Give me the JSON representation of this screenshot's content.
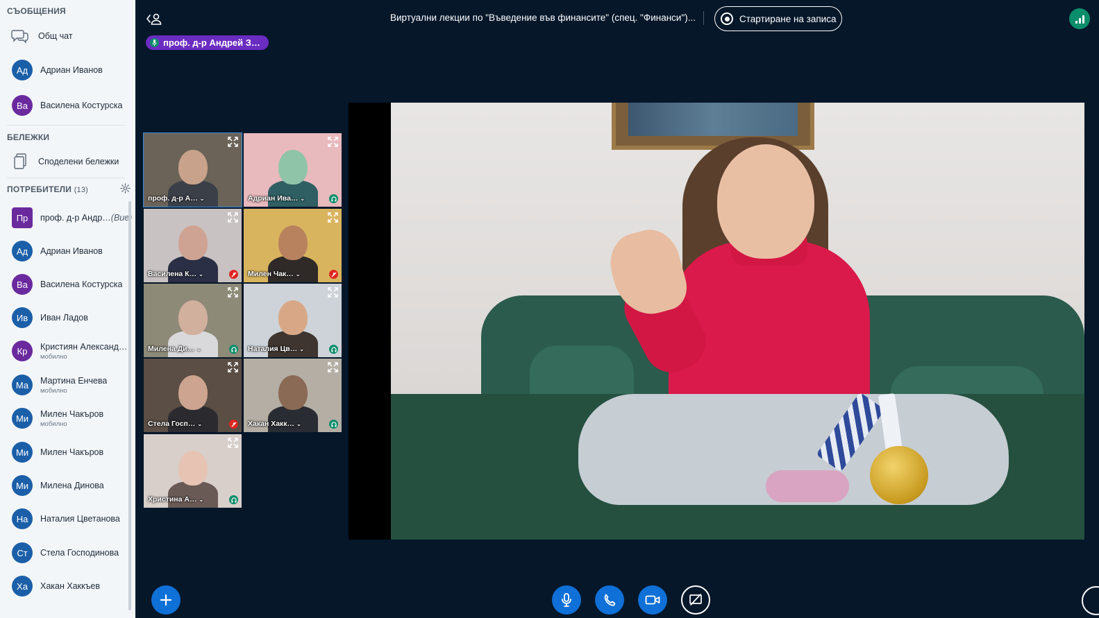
{
  "sidebar": {
    "messages_title": "СЪОБЩЕНИЯ",
    "public_chat": "Общ чат",
    "private_chats": [
      {
        "initials": "Ад",
        "name": "Адриан Иванов",
        "color": "#1B5FA8"
      },
      {
        "initials": "Ва",
        "name": "Василена Костурска",
        "color": "#6A2A9E"
      }
    ],
    "notes_title": "БЕЛЕЖКИ",
    "shared_notes": "Споделени бележки",
    "users_title": "ПОТРЕБИТЕЛИ",
    "users_count": "(13)",
    "users": [
      {
        "initials": "Пр",
        "name": "проф. д-р Андр…",
        "you": "(Вие)",
        "sub": "",
        "color": "#6A2A9E",
        "status": "listen",
        "presenter": true
      },
      {
        "initials": "Ад",
        "name": "Адриан Иванов",
        "you": "",
        "sub": "",
        "color": "#1B5FA8",
        "status": "listen"
      },
      {
        "initials": "Ва",
        "name": "Василена Костурска",
        "you": "",
        "sub": "",
        "color": "#6A2A9E",
        "status": "muted"
      },
      {
        "initials": "Ив",
        "name": "Иван Ладов",
        "you": "",
        "sub": "",
        "color": "#1B5FA8",
        "status": "listen"
      },
      {
        "initials": "Кр",
        "name": "Кристиян Александ…",
        "you": "",
        "sub": "мобилно",
        "color": "#6A2A9E",
        "status": "listen"
      },
      {
        "initials": "Ма",
        "name": "Мартина Енчева",
        "you": "",
        "sub": "мобилно",
        "color": "#1B5FA8",
        "status": "listen"
      },
      {
        "initials": "Ми",
        "name": "Милен Чакъров",
        "you": "",
        "sub": "мобилно",
        "color": "#1B5FA8",
        "status": "muted"
      },
      {
        "initials": "Ми",
        "name": "Милен Чакъров",
        "you": "",
        "sub": "",
        "color": "#1B5FA8",
        "status": "listen"
      },
      {
        "initials": "Ми",
        "name": "Милена Динова",
        "you": "",
        "sub": "",
        "color": "#1B5FA8",
        "status": "listen"
      },
      {
        "initials": "На",
        "name": "Наталия Цветанова",
        "you": "",
        "sub": "",
        "color": "#1B5FA8",
        "status": "listen"
      },
      {
        "initials": "Ст",
        "name": "Стела Господинова",
        "you": "",
        "sub": "",
        "color": "#1B5FA8",
        "status": "muted"
      },
      {
        "initials": "Ха",
        "name": "Хакан Хаккъев",
        "you": "",
        "sub": "",
        "color": "#1B5FA8",
        "status": "listen"
      }
    ]
  },
  "topbar": {
    "meeting_title": "Виртуални лекции по \"Въведение във финансите\" (спец. \"Финанси\")...",
    "record_label": "Стартиране на записа",
    "talking_indicator": "проф. д-р Андрей З…"
  },
  "video_tiles": [
    {
      "name": "проф. д-р А…",
      "status": "none",
      "active": true,
      "bg": "#6B6358",
      "skin": "#C8A28A",
      "shirt": "#3B3F48"
    },
    {
      "name": "Адриан Ива…",
      "status": "listen",
      "active": false,
      "bg": "#E8B9BD",
      "skin": "#8FC4A8",
      "shirt": "#2F5F63"
    },
    {
      "name": "Василена К…",
      "status": "muted",
      "active": false,
      "bg": "#C9C2C2",
      "skin": "#CFA393",
      "shirt": "#2A2F45"
    },
    {
      "name": "Милен Чак…",
      "status": "muted",
      "active": false,
      "bg": "#D9B45E",
      "skin": "#B9825E",
      "shirt": "#2F2A28"
    },
    {
      "name": "Милена Ди…",
      "status": "listen",
      "active": false,
      "bg": "#8E8A78",
      "skin": "#D2B09E",
      "shirt": "#D9D9DC"
    },
    {
      "name": "Наталия Цв…",
      "status": "listen",
      "active": false,
      "bg": "#CDD3D8",
      "skin": "#D8A886",
      "shirt": "#3E3530"
    },
    {
      "name": "Стела Госп…",
      "status": "muted",
      "active": false,
      "bg": "#5A4E45",
      "skin": "#CCA48F",
      "shirt": "#2B2B2F"
    },
    {
      "name": "Хакан Хакк…",
      "status": "listen",
      "active": false,
      "bg": "#B4AEA4",
      "skin": "#8A6A55",
      "shirt": "#2A2C33"
    },
    {
      "name": "Христина А…",
      "status": "listen",
      "active": false,
      "bg": "#D8CFCB",
      "skin": "#E6C3B2",
      "shirt": "#6A5A55"
    }
  ],
  "colors": {
    "app_bg": "#06172A",
    "sidebar_bg": "#F3F6F9",
    "accent_blue": "#0F70D7",
    "talker_purple": "#6A2CC1",
    "listen_green": "#0B8E6B",
    "muted_red": "#DF2721"
  },
  "controls": [
    {
      "icon": "plus-icon",
      "style": "blue"
    },
    {
      "icon": "microphone-icon",
      "style": "blue"
    },
    {
      "icon": "phone-icon",
      "style": "blue"
    },
    {
      "icon": "video-camera-icon",
      "style": "blue"
    },
    {
      "icon": "screen-share-off-icon",
      "style": "outline"
    }
  ]
}
